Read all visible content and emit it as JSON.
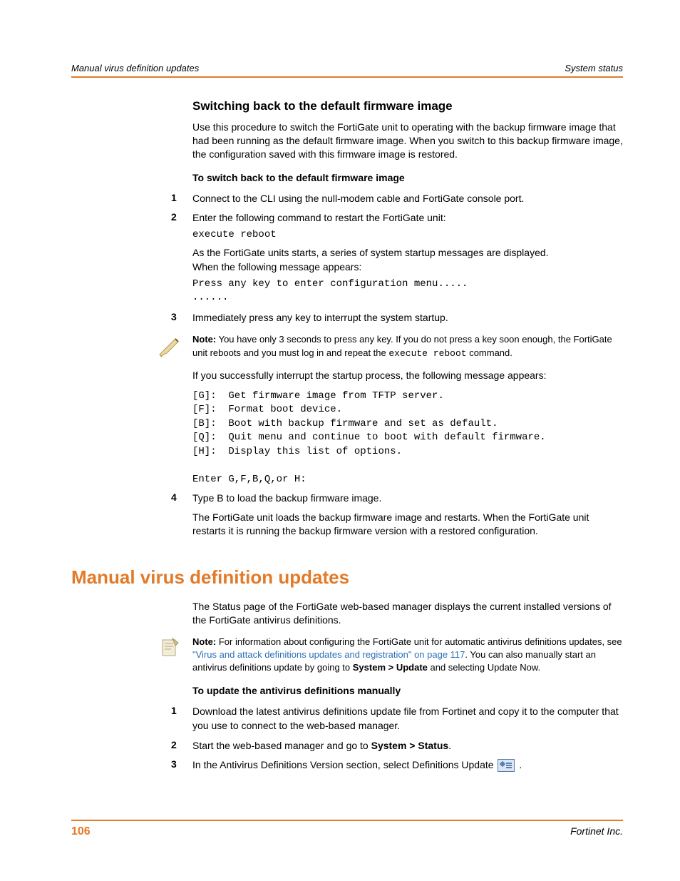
{
  "header": {
    "left": "Manual virus definition updates",
    "right": "System status"
  },
  "section1": {
    "heading": "Switching back to the default firmware image",
    "intro": "Use this procedure to switch the FortiGate unit to operating with the backup firmware image that had been running as the default firmware image. When you switch to this backup firmware image, the configuration saved with this firmware image is restored.",
    "procTitle": "To switch back to the default firmware image",
    "steps": [
      {
        "n": "1",
        "text": "Connect to the CLI using the null-modem cable and FortiGate console port."
      },
      {
        "n": "2",
        "text": "Enter the following command to restart the FortiGate unit:"
      },
      {
        "n": "3",
        "text": "Immediately press any key to interrupt the system startup."
      },
      {
        "n": "4",
        "text": "Type B to load the backup firmware image."
      }
    ],
    "code1": "execute reboot",
    "after2a": "As the FortiGate units starts, a series of system startup messages are displayed.",
    "after2b": "When the following message appears:",
    "code2": "Press any key to enter configuration menu.....\n......",
    "noteLabel": "Note:",
    "noteTextA": " You have only 3 seconds to press any key. If you do not press a key soon enough, the FortiGate unit reboots and you must log in and repeat the ",
    "noteCode": "execute reboot",
    "noteTextB": " command.",
    "afterNote": "If you successfully interrupt the startup process, the following message appears:",
    "code3": "[G]:  Get firmware image from TFTP server.\n[F]:  Format boot device.\n[B]:  Boot with backup firmware and set as default.\n[Q]:  Quit menu and continue to boot with default firmware.\n[H]:  Display this list of options.\n\nEnter G,F,B,Q,or H:",
    "after4": "The FortiGate unit loads the backup firmware image and restarts. When the FortiGate unit restarts it is running the backup firmware version with a restored configuration."
  },
  "section2": {
    "heading": "Manual virus definition updates",
    "intro": "The Status page of the FortiGate web-based manager displays the current installed versions of the FortiGate antivirus definitions.",
    "noteLabel": "Note:",
    "noteA": " For information about configuring the FortiGate unit for automatic antivirus definitions updates, see ",
    "noteLink": "\"Virus and attack definitions updates and registration\" on page 117",
    "noteB": ". You can also manually start an antivirus definitions update by going to ",
    "noteBold": "System > Update",
    "noteC": " and selecting Update Now.",
    "procTitle": "To update the antivirus definitions manually",
    "steps": [
      {
        "n": "1",
        "text": "Download the latest antivirus definitions update file from Fortinet and copy it to the computer that you use to connect to the web-based manager."
      },
      {
        "n": "2",
        "a": "Start the web-based manager and go to ",
        "bold": "System > Status",
        "b": "."
      },
      {
        "n": "3",
        "a": "In the Antivirus Definitions Version section, select Definitions Update  ",
        "b": " ."
      }
    ]
  },
  "footer": {
    "page": "106",
    "company": "Fortinet Inc."
  }
}
